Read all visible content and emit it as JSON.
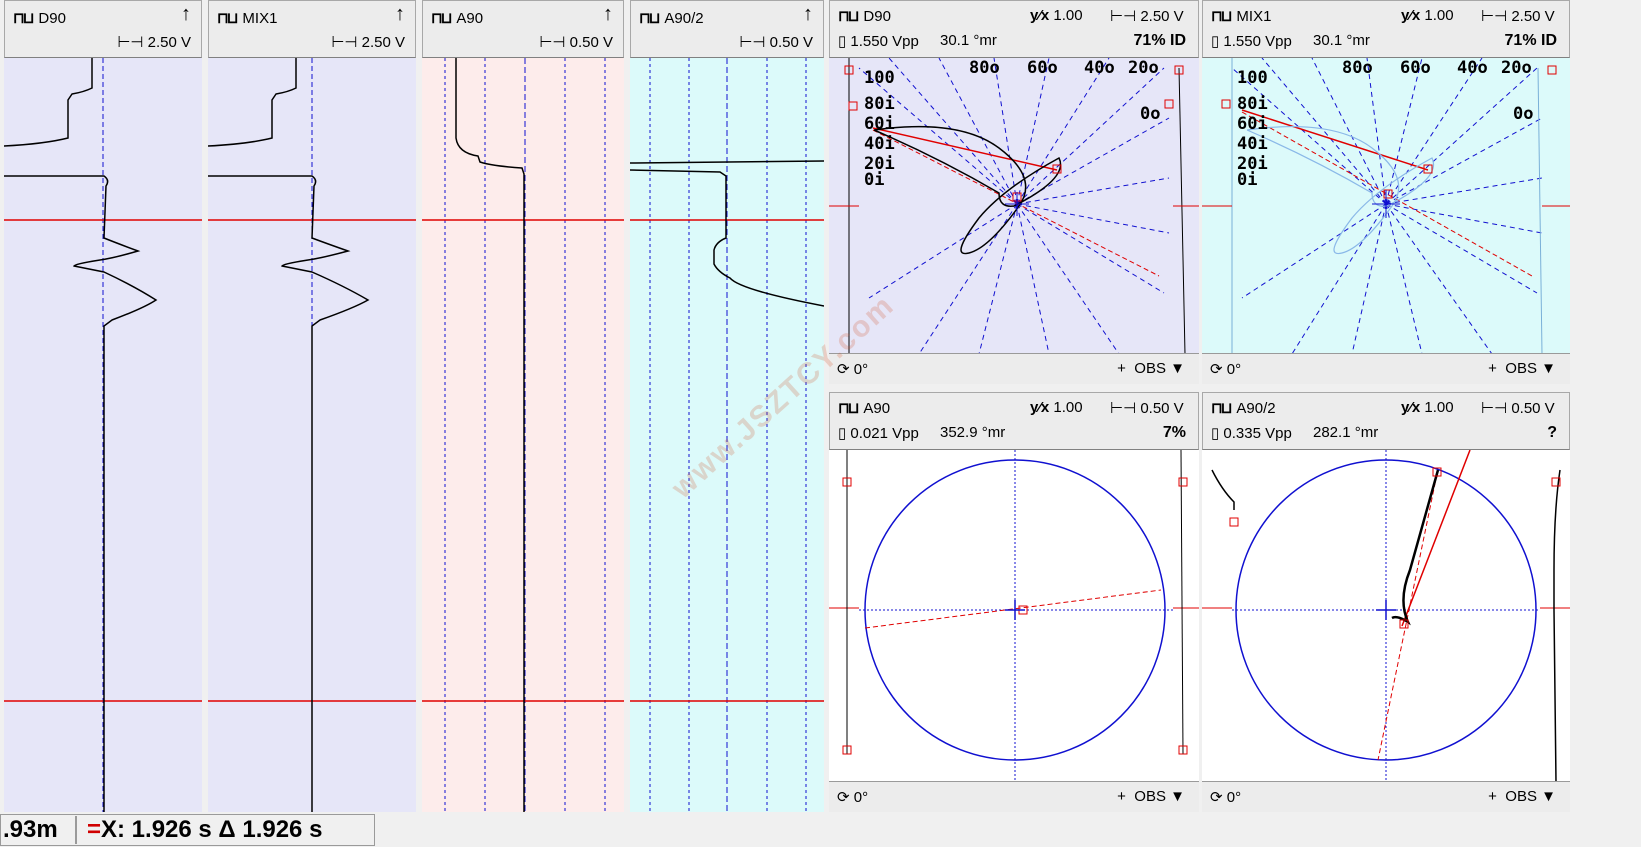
{
  "strip_channels": [
    {
      "name": "D90",
      "scale": "2.50 V",
      "bg": "#e6e6f8"
    },
    {
      "name": "MIX1",
      "scale": "2.50 V",
      "bg": "#e6e6f8"
    },
    {
      "name": "A90",
      "scale": "0.50 V",
      "bg": "#fdeceb"
    },
    {
      "name": "A90/2",
      "scale": "0.50 V",
      "bg": "#dcfafa"
    }
  ],
  "lissajous": [
    {
      "name": "D90",
      "gain": "1.00",
      "scale": "2.50 V",
      "vpp": "1.550 Vpp",
      "angle": "30.1 °mr",
      "result": "71% ID",
      "rotation": "0°",
      "mode": "OBS",
      "bg": "#e6e6f8",
      "cal_labels": [
        "100",
        "80i",
        "60i",
        "40i",
        "20i",
        "0i",
        "80o",
        "60o",
        "40o",
        "20o",
        "0o"
      ]
    },
    {
      "name": "MIX1",
      "gain": "1.00",
      "scale": "2.50 V",
      "vpp": "1.550 Vpp",
      "angle": "30.1 °mr",
      "result": "71% ID",
      "rotation": "0°",
      "mode": "OBS",
      "bg": "#dcfafa",
      "cal_labels": [
        "100",
        "80i",
        "60i",
        "40i",
        "20i",
        "0i",
        "80o",
        "60o",
        "40o",
        "20o",
        "0o"
      ]
    },
    {
      "name": "A90",
      "gain": "1.00",
      "scale": "0.50 V",
      "vpp": "0.021 Vpp",
      "angle": "352.9 °mr",
      "result": "7%",
      "rotation": "0°",
      "mode": "OBS",
      "bg": "#ffffff"
    },
    {
      "name": "A90/2",
      "gain": "1.00",
      "scale": "0.50 V",
      "vpp": "0.335 Vpp",
      "angle": "282.1 °mr",
      "result": "?",
      "rotation": "0°",
      "mode": "OBS",
      "bg": "#ffffff"
    }
  ],
  "status": {
    "position": ".93m",
    "cursor_prefix": "=",
    "cursor": "X: 1.926 s Δ 1.926 s"
  },
  "icons": {
    "channel": "signal-icon",
    "scale": "span-icon",
    "probe": "probe-icon",
    "rotate": "rotate-icon",
    "marker": "add-marker-icon",
    "dropdown": "triangle-down-icon"
  },
  "watermark": "www.JSZTCY.com"
}
